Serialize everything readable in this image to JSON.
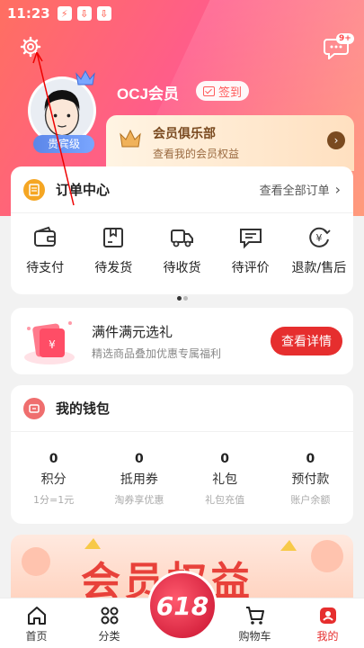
{
  "status_bar": {
    "time": "11:23"
  },
  "header": {
    "message_badge": "9+"
  },
  "profile": {
    "username": "OCJ会员",
    "level": "贵宾级",
    "signin_label": "签到"
  },
  "club": {
    "title": "会员俱乐部",
    "subtitle": "查看我的会员权益"
  },
  "orders": {
    "title": "订单中心",
    "view_all": "查看全部订单",
    "items": [
      {
        "label": "待支付",
        "icon": "wallet-icon"
      },
      {
        "label": "待发货",
        "icon": "package-icon"
      },
      {
        "label": "待收货",
        "icon": "truck-icon"
      },
      {
        "label": "待评价",
        "icon": "comment-icon"
      },
      {
        "label": "退款/售后",
        "icon": "refund-icon"
      }
    ]
  },
  "promo": {
    "title": "满件满元选礼",
    "subtitle": "精选商品叠加优惠专属福利",
    "button": "查看详情"
  },
  "wallet": {
    "title": "我的钱包",
    "items": [
      {
        "value": "0",
        "label": "积分",
        "desc": "1分=1元"
      },
      {
        "value": "0",
        "label": "抵用券",
        "desc": "淘券享优惠"
      },
      {
        "value": "0",
        "label": "礼包",
        "desc": "礼包充值"
      },
      {
        "value": "0",
        "label": "预付款",
        "desc": "账户余额"
      }
    ]
  },
  "banner": {
    "text": "会员权益"
  },
  "tabbar": {
    "items": [
      {
        "label": "首页",
        "icon": "home-icon"
      },
      {
        "label": "分类",
        "icon": "category-icon"
      },
      {
        "label": "618",
        "icon": "promo-618-icon"
      },
      {
        "label": "购物车",
        "icon": "cart-icon"
      },
      {
        "label": "我的",
        "icon": "profile-icon"
      }
    ],
    "active": "我的"
  },
  "colors": {
    "accent": "#e62e2e",
    "hero_start": "#ff6f61",
    "hero_end": "#ff9a7a",
    "level_badge": "#5b86e8"
  }
}
